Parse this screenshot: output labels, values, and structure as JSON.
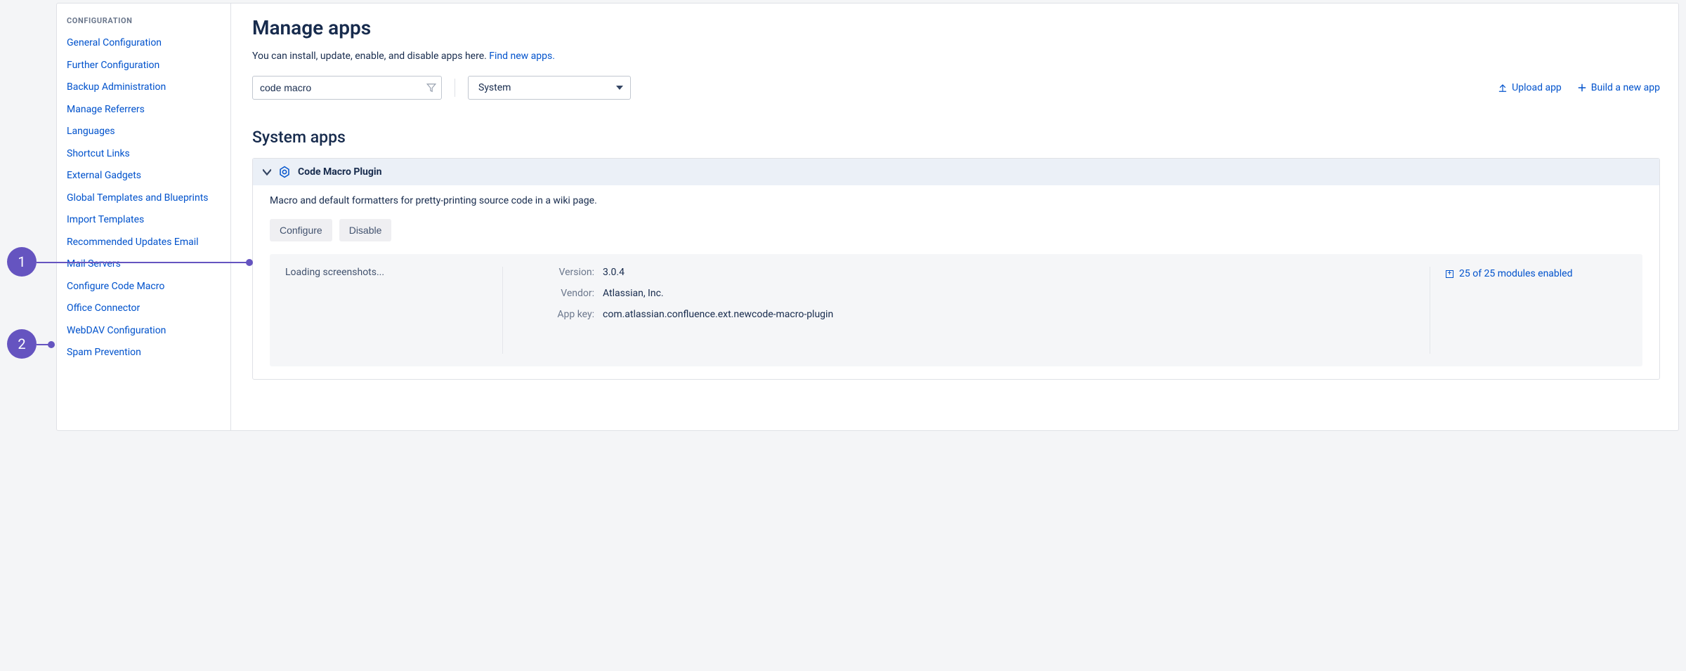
{
  "annotations": {
    "one": "1",
    "two": "2"
  },
  "sidebar": {
    "section_header": "CONFIGURATION",
    "items": [
      "General Configuration",
      "Further Configuration",
      "Backup Administration",
      "Manage Referrers",
      "Languages",
      "Shortcut Links",
      "External Gadgets",
      "Global Templates and Blueprints",
      "Import Templates",
      "Recommended Updates Email",
      "Mail Servers",
      "Configure Code Macro",
      "Office Connector",
      "WebDAV Configuration",
      "Spam Prevention"
    ]
  },
  "main": {
    "title": "Manage apps",
    "intro_text": "You can install, update, enable, and disable apps here. ",
    "intro_link": "Find new apps.",
    "filter_value": "code macro",
    "category_value": "System",
    "upload_label": "Upload app",
    "build_label": "Build a new app",
    "section_title": "System apps"
  },
  "app": {
    "name": "Code Macro Plugin",
    "description": "Macro and default formatters for pretty-printing source code in a wiki page.",
    "configure_label": "Configure",
    "disable_label": "Disable",
    "loading": "Loading screenshots...",
    "kv": {
      "version_k": "Version:",
      "version_v": "3.0.4",
      "vendor_k": "Vendor:",
      "vendor_v": "Atlassian, Inc.",
      "appkey_k": "App key:",
      "appkey_v": "com.atlassian.confluence.ext.newcode-macro-plugin"
    },
    "modules_text": "25 of 25 modules enabled"
  }
}
